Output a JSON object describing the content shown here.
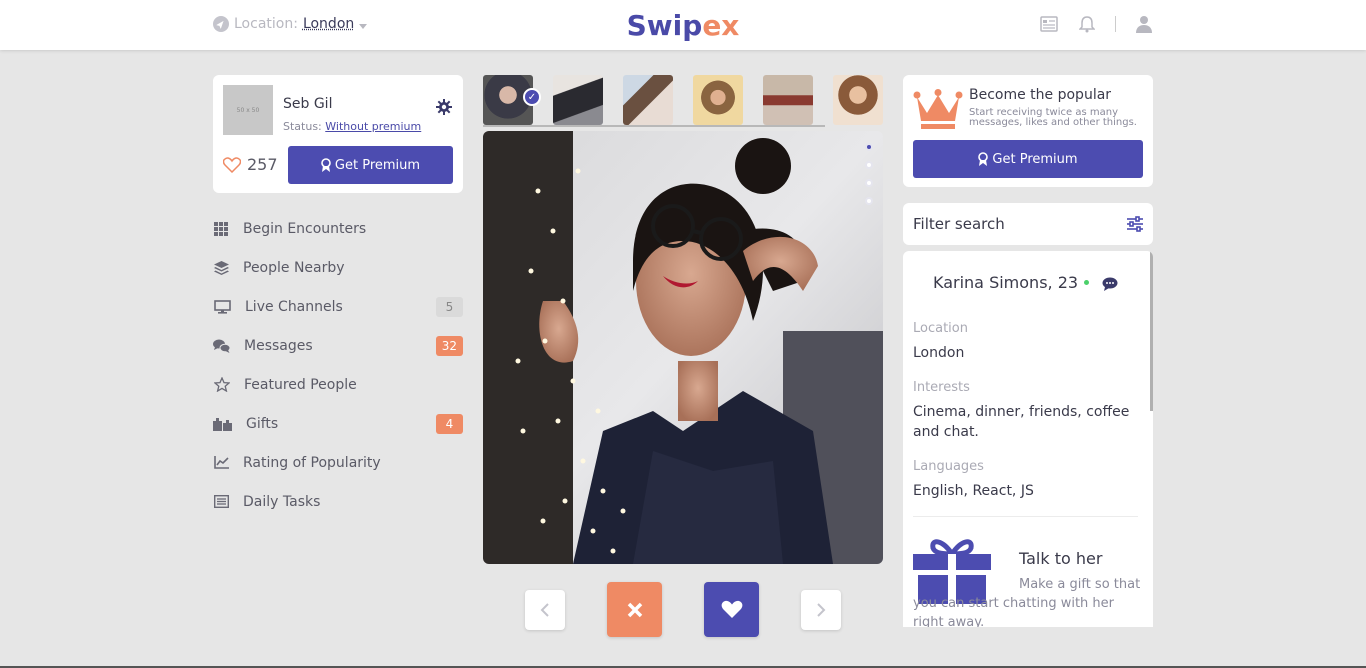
{
  "header": {
    "location_label": "Location:",
    "location_value": "London",
    "logo_part1": "Swip",
    "logo_part2": "ex"
  },
  "profile": {
    "avatar_text": "50 x 50",
    "name": "Seb Gil",
    "status_label": "Status:",
    "status_value": "Without premium",
    "likes": "257",
    "premium_button": "Get Premium"
  },
  "menu": [
    {
      "label": "Begin Encounters",
      "icon": "grid-icon",
      "badge": null
    },
    {
      "label": "People Nearby",
      "icon": "layers-icon",
      "badge": null
    },
    {
      "label": "Live Channels",
      "icon": "monitor-icon",
      "badge": "5",
      "badge_style": "grey"
    },
    {
      "label": "Messages",
      "icon": "chat-bubbles-icon",
      "badge": "32",
      "badge_style": "orange"
    },
    {
      "label": "Featured People",
      "icon": "star-icon",
      "badge": null
    },
    {
      "label": "Gifts",
      "icon": "gifts-icon",
      "badge": "4",
      "badge_style": "orange"
    },
    {
      "label": "Rating of Popularity",
      "icon": "chart-icon",
      "badge": null
    },
    {
      "label": "Daily Tasks",
      "icon": "list-icon",
      "badge": null
    }
  ],
  "popular": {
    "title": "Become the popular",
    "subtitle": "Start receiving twice as many messages, likes and other things.",
    "button": "Get Premium"
  },
  "filter": {
    "title": "Filter search"
  },
  "person": {
    "name": "Karina Simons, 23",
    "location_label": "Location",
    "location_value": "London",
    "interests_label": "Interests",
    "interests_value": "Cinema, dinner, friends, coffee and chat.",
    "languages_label": "Languages",
    "languages_value": "English, React, JS",
    "gift_title": "Talk to her",
    "gift_text": "Make a gift so that you can start chatting with her right away."
  },
  "colors": {
    "accent": "#4c4cb0",
    "orange": "#ef8a64",
    "online": "#4bd06a"
  }
}
